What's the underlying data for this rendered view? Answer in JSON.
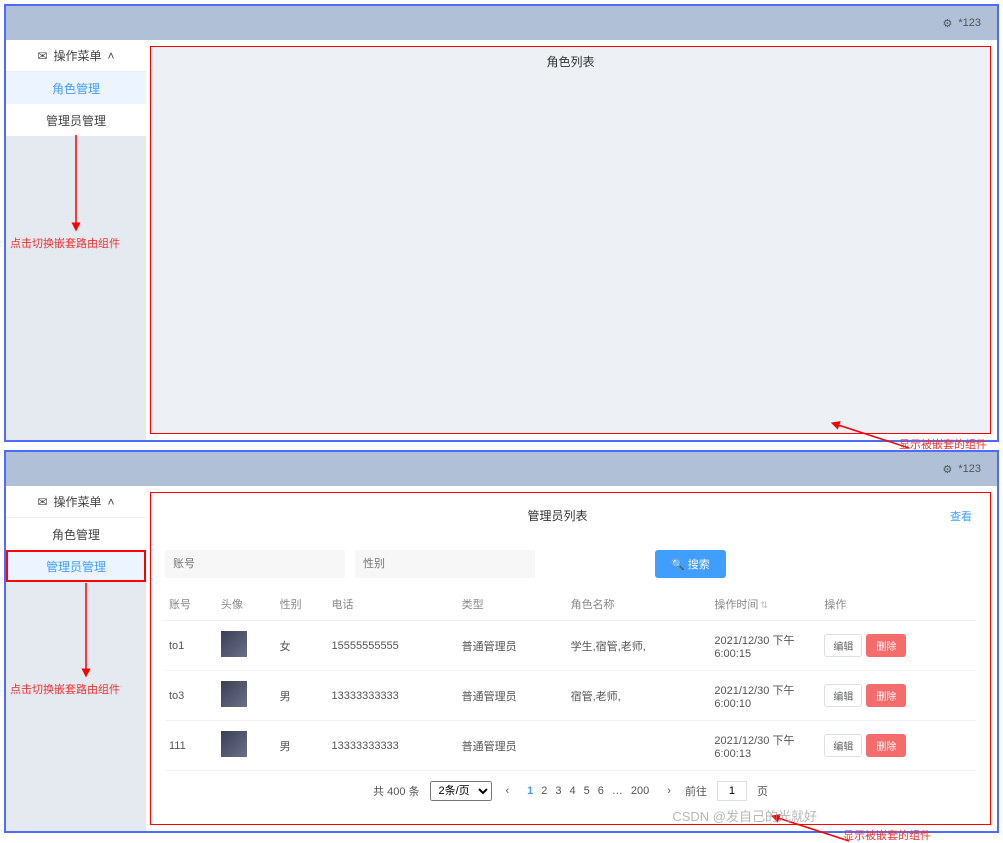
{
  "topbar": {
    "user": "*123"
  },
  "sidebar": {
    "header": "操作菜单",
    "item_role": "角色管理",
    "item_admin": "管理员管理"
  },
  "annotations": {
    "click_switch": "点击切换嵌套路由组件",
    "show_nested": "显示被嵌套的组件"
  },
  "panel1": {
    "title": "角色列表"
  },
  "panel2": {
    "title": "管理员列表",
    "view_link": "查看",
    "search": {
      "ph_account": "账号",
      "ph_gender": "性别",
      "btn": "搜索"
    },
    "columns": {
      "account": "账号",
      "avatar": "头像",
      "gender": "性别",
      "phone": "电话",
      "type": "类型",
      "role_name": "角色名称",
      "op_time": "操作时间",
      "ops": "操作"
    },
    "actions": {
      "edit": "编辑",
      "delete": "删除"
    },
    "rows": [
      {
        "account": "to1",
        "gender": "女",
        "phone": "15555555555",
        "type": "普通管理员",
        "role": "学生,宿管,老师,",
        "time": "2021/12/30 下午6:00:15"
      },
      {
        "account": "to3",
        "gender": "男",
        "phone": "13333333333",
        "type": "普通管理员",
        "role": "宿管,老师,",
        "time": "2021/12/30 下午6:00:10"
      },
      {
        "account": "111",
        "gender": "男",
        "phone": "13333333333",
        "type": "普通管理员",
        "role": "",
        "time": "2021/12/30 下午6:00:13"
      }
    ],
    "pager": {
      "total": "共 400 条",
      "per_page": "2条/页",
      "pages": [
        "1",
        "2",
        "3",
        "4",
        "5",
        "6",
        "…",
        "200"
      ],
      "goto_label": "前往",
      "goto_val": "1",
      "page_suffix": "页"
    }
  },
  "watermark": "CSDN @发自己的光就好"
}
